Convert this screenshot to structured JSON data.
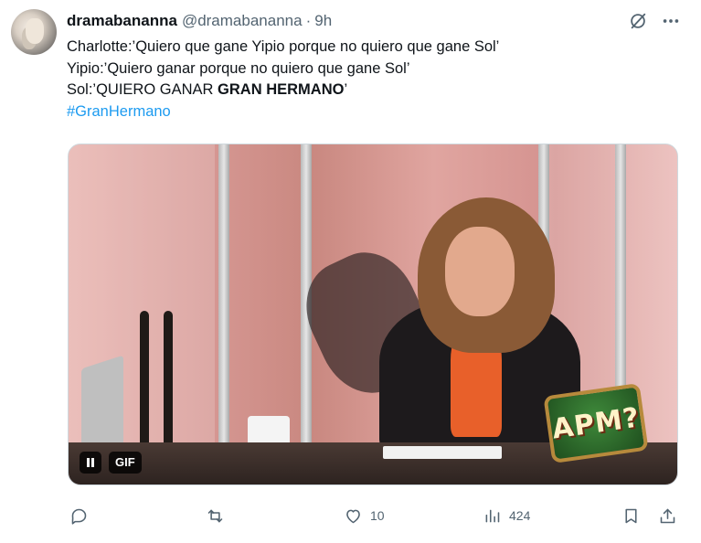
{
  "tweet": {
    "display_name": "dramabananna",
    "handle": "@dramabananna",
    "separator": "·",
    "time": "9h",
    "lines": [
      "Charlotte:’Quiero que gane Yipio porque no quiero que gane Sol’",
      "Yipio:’Quiero ganar porque no quiero que gane Sol’"
    ],
    "line3_prefix": "Sol:’QUIERO GANAR ",
    "line3_bold": "GRAN HERMANO",
    "line3_suffix": "’",
    "hashtag": "#GranHermano"
  },
  "media": {
    "gif_label": "GIF",
    "overlay_logo_text": "APM?"
  },
  "actions": {
    "reply_count": "",
    "retweet_count": "",
    "like_count": "10",
    "views_count": "424"
  },
  "icons": {
    "grok": "grok-icon",
    "more": "more-icon",
    "reply": "reply-icon",
    "retweet": "retweet-icon",
    "like": "heart-icon",
    "views": "views-icon",
    "bookmark": "bookmark-icon",
    "share": "share-icon",
    "pause": "pause-icon"
  },
  "colors": {
    "text": "#0f1419",
    "secondary": "#536471",
    "link": "#1d9bf0"
  }
}
